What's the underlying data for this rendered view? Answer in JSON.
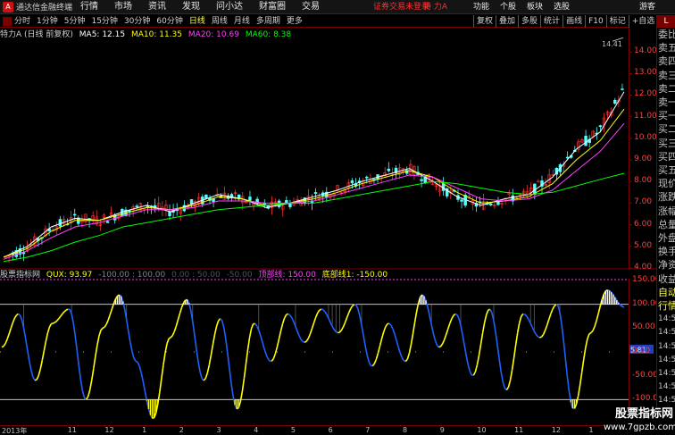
{
  "app": {
    "title": "通达信金融终端",
    "logo": "A"
  },
  "menu": [
    "行情",
    "市场",
    "资讯",
    "发现",
    "问小达",
    "财富圈",
    "交易"
  ],
  "login_status": "证券交易未登录",
  "stock_name": "特 力A",
  "right_menu": [
    "功能",
    "个股",
    "板块",
    "选股"
  ],
  "guest": "游客",
  "periods": [
    "分时",
    "1分钟",
    "5分钟",
    "15分钟",
    "30分钟",
    "60分钟",
    "日线",
    "周线",
    "月线",
    "多周期",
    "更多"
  ],
  "active_period": "日线",
  "toolbar": [
    "复权",
    "叠加",
    "多股",
    "统计",
    "画线",
    "F10",
    "标记",
    "+自选"
  ],
  "toolbar_close": "×",
  "legend": {
    "title": "特力A (日线 前复权)",
    "ma5": "MA5: 12.15",
    "ma10": "MA10: 11.35",
    "ma20": "MA20: 10.69",
    "ma60": "MA60: 8.38"
  },
  "colors": {
    "ma5": "#ffffff",
    "ma10": "#ffff00",
    "ma20": "#ff40ff",
    "ma60": "#00ff00",
    "up": "#ff3232",
    "down": "#54ffff",
    "axis": "#ff4040",
    "ind_line_up": "#ffff00",
    "ind_line_down": "#2060ff"
  },
  "price_axis": [
    "14.00",
    "13.00",
    "12.00",
    "11.00",
    "10.00",
    "9.00",
    "8.00",
    "7.00",
    "6.00",
    "5.00",
    "4.00"
  ],
  "max_label": "14.41",
  "ind_header": {
    "title": "股票指标网",
    "value": "QUX: 93.97",
    "params": "-100.00 : 100.00",
    "params2": "0.00 : 50.00",
    "params3": "-50.00",
    "top_label": "顶部线: 150.00",
    "bottom_label": "底部线1: -150.00"
  },
  "ind_axis": [
    "150.00",
    "100.00",
    "50.00",
    "0.00",
    "-50.00",
    "-100.00",
    "-150.00"
  ],
  "ind_current": "5.81",
  "date_axis": [
    "2013年",
    "11",
    "12",
    "1",
    "2",
    "3",
    "4",
    "5",
    "6",
    "7",
    "8",
    "9",
    "10",
    "11",
    "12",
    "1",
    "2"
  ],
  "side_panel": {
    "head": "L",
    "rows": [
      "委比",
      "卖五",
      "卖四",
      "卖三",
      "卖二",
      "卖一",
      "买一",
      "买二",
      "买三",
      "买四",
      "买五",
      "现价",
      "涨跌",
      "涨幅",
      "总量",
      "外盘",
      "换手",
      "净资",
      "收益",
      "自动",
      "行情",
      "14:5",
      "14:5",
      "14:5",
      "14:5",
      "14:5",
      "14:5",
      "14:5",
      "14:5"
    ]
  },
  "watermark": {
    "title": "股票指标网",
    "url": "www.7gpzb.com"
  },
  "chart_data": {
    "type": "line",
    "title": "特力A (日线 前复权)",
    "series": [
      {
        "name": "MA5",
        "values": [
          4.5,
          5.0,
          5.9,
          6.3,
          6.2,
          6.6,
          6.9,
          6.6,
          7.0,
          7.4,
          7.2,
          6.8,
          7.0,
          7.3,
          7.6,
          8.0,
          8.3,
          8.6,
          8.0,
          7.3,
          6.9,
          7.2,
          7.4,
          8.2,
          9.5,
          10.3,
          12.15
        ]
      },
      {
        "name": "MA10",
        "values": [
          4.5,
          4.9,
          5.7,
          6.2,
          6.2,
          6.5,
          6.8,
          6.7,
          6.9,
          7.3,
          7.2,
          6.9,
          7.0,
          7.2,
          7.5,
          7.9,
          8.2,
          8.5,
          8.2,
          7.5,
          7.0,
          7.1,
          7.3,
          7.9,
          9.0,
          9.9,
          11.35
        ]
      },
      {
        "name": "MA20",
        "values": [
          4.4,
          4.8,
          5.4,
          5.9,
          6.1,
          6.4,
          6.7,
          6.7,
          6.8,
          7.1,
          7.1,
          7.0,
          7.0,
          7.1,
          7.4,
          7.7,
          8.0,
          8.3,
          8.2,
          7.7,
          7.2,
          7.1,
          7.2,
          7.6,
          8.5,
          9.4,
          10.69
        ]
      },
      {
        "name": "MA60",
        "values": [
          4.3,
          4.5,
          4.8,
          5.2,
          5.5,
          5.9,
          6.1,
          6.3,
          6.5,
          6.7,
          6.8,
          6.9,
          7.0,
          7.0,
          7.2,
          7.4,
          7.6,
          7.8,
          8.0,
          7.9,
          7.7,
          7.5,
          7.4,
          7.5,
          7.8,
          8.1,
          8.38
        ]
      }
    ],
    "ylim": [
      4.0,
      14.5
    ],
    "indicator": {
      "name": "QUX",
      "values": [
        10,
        80,
        -60,
        60,
        90,
        -100,
        50,
        120,
        -20,
        -140,
        30,
        110,
        -60,
        70,
        -120,
        60,
        -20,
        80,
        20,
        90,
        40,
        100,
        -30,
        60,
        -20,
        120,
        10,
        80,
        -50,
        90,
        -80,
        80,
        30,
        100,
        -120,
        40,
        130,
        93.97
      ],
      "ylim": [
        -150,
        150
      ]
    }
  }
}
